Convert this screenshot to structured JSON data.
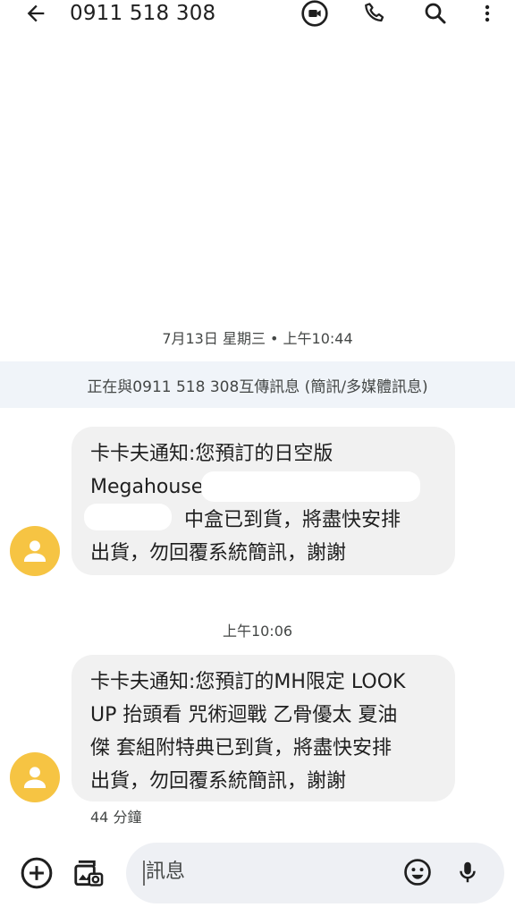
{
  "header": {
    "title": "0911 518 308",
    "icons": [
      "back-arrow-icon",
      "video-call-icon",
      "phone-icon",
      "search-icon",
      "more-vert-icon"
    ]
  },
  "conversation": {
    "date_separator": "7月13日 星期三 • 上午10:44",
    "mode_banner": "正在與0911 518 308互傳訊息 (簡訊/多媒體訊息)",
    "messages": [
      {
        "lines": [
          "卡卡夫通知:您預訂的日空版",
          "Megahouse",
          "中盒已到貨，將盡快安排",
          "出貨，勿回覆系統簡訊，謝謝"
        ]
      },
      {
        "time_separator": "上午10:06",
        "lines": [
          "卡卡夫通知:您預訂的MH限定 LOOK",
          "UP 抬頭看 咒術迴戰 乙骨優太 夏油",
          "傑 套組附特典已到貨，將盡快安排",
          "出貨，勿回覆系統簡訊，謝謝"
        ],
        "timestamp": "44 分鐘"
      }
    ]
  },
  "compose": {
    "placeholder": "訊息",
    "icons": [
      "add-circle-icon",
      "gallery-icon",
      "emoji-icon",
      "mic-icon"
    ]
  },
  "colors": {
    "bubble": "#f1f1f1",
    "avatar": "#f6c443",
    "banner": "#f0f4f9",
    "input": "#eef0f4"
  }
}
